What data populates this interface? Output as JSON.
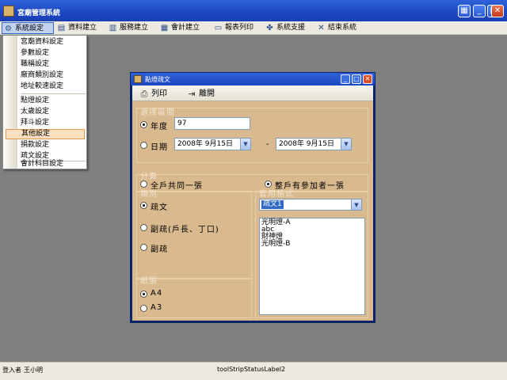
{
  "app": {
    "title": "宮廟管理系統",
    "buttons": {
      "tile": "▦",
      "minimize": "_",
      "maximize": "□",
      "close": "✕"
    }
  },
  "menubar": {
    "items": [
      {
        "label": "系統設定",
        "icon": "gear-icon",
        "glyph": "⚙"
      },
      {
        "label": "資料建立",
        "icon": "folder-icon",
        "glyph": "▤"
      },
      {
        "label": "服務建立",
        "icon": "service-icon",
        "glyph": "▥"
      },
      {
        "label": "會計建立",
        "icon": "account-icon",
        "glyph": "▦"
      },
      {
        "label": "報表列印",
        "icon": "report-icon",
        "glyph": "▭"
      },
      {
        "label": "系統支援",
        "icon": "support-icon",
        "glyph": "✤"
      },
      {
        "label": "結束系統",
        "icon": "exit-icon",
        "glyph": "✕"
      }
    ]
  },
  "dropdown": {
    "items": [
      "宮廟資料設定",
      "參數設定",
      "職稱設定",
      "廠商類別設定",
      "地址較速設定",
      "點燈設定",
      "太歲設定",
      "拜斗設定",
      "其他設定",
      "捐款設定",
      "疏文設定",
      "會計科目設定"
    ]
  },
  "dialog": {
    "title": "點燈疏文",
    "toolbar": {
      "print": "列印",
      "close": "離開"
    },
    "period": {
      "label": "選擇區間",
      "year_label": "年度",
      "year_value": "97",
      "date_label": "日期",
      "date_from": "2008年 9月15日",
      "date_to": "2008年 9月15日",
      "dash": "-"
    },
    "category": {
      "label": "分頁",
      "option_all": "全戶共同一張",
      "option_each": "整戶有參加者一張"
    },
    "kind": {
      "label": "類別",
      "option_1": "疏文",
      "option_2": "副疏(戶長、丁口)",
      "option_3": "副疏"
    },
    "format": {
      "label": "套用格式",
      "selected": "疏文1",
      "list": [
        "光明燈-A",
        "abc",
        "財神燈",
        "光明燈-B"
      ]
    },
    "paper": {
      "label": "紙張",
      "option_a4": "A4",
      "option_a3": "A3"
    }
  },
  "status": {
    "login_label": "登入者",
    "user": "王小明",
    "label2": "toolStripStatusLabel2"
  }
}
